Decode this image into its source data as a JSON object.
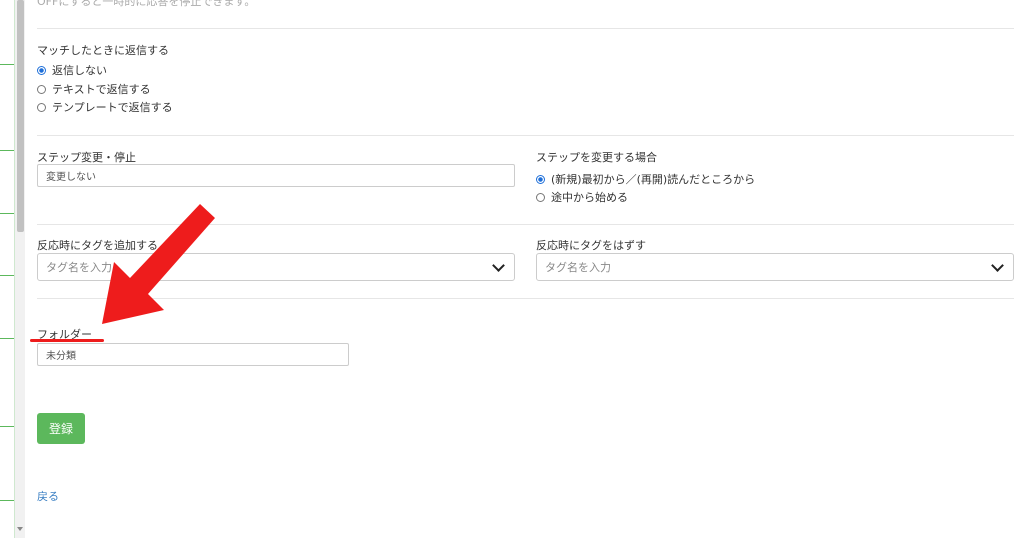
{
  "header_note": "OFFにすると一時的に応答を停止できます。",
  "reply": {
    "label": "マッチしたときに返信する",
    "options": [
      "返信しない",
      "テキストで返信する",
      "テンプレートで返信する"
    ],
    "selected_index": 0
  },
  "step": {
    "label": "ステップ変更・停止",
    "value": "変更しない",
    "mode_label": "ステップを変更する場合",
    "mode_options": [
      "(新規)最初から／(再開)読んだところから",
      "途中から始める"
    ],
    "mode_selected_index": 0
  },
  "tags": {
    "add_label": "反応時にタグを追加する",
    "add_placeholder": "タグ名を入力",
    "remove_label": "反応時にタグをはずす",
    "remove_placeholder": "タグ名を入力"
  },
  "folder": {
    "label": "フォルダー",
    "value": "未分類"
  },
  "actions": {
    "submit_label": "登録",
    "back_label": "戻る"
  },
  "colors": {
    "primary_button": "#5cb85c",
    "link": "#3a7fc3",
    "radio_selected": "#1e6fd9",
    "annotation_red": "#ee1c1c"
  },
  "icons": {
    "select_caret": "chevron-down-icon",
    "annotation": "red-arrow-icon"
  }
}
